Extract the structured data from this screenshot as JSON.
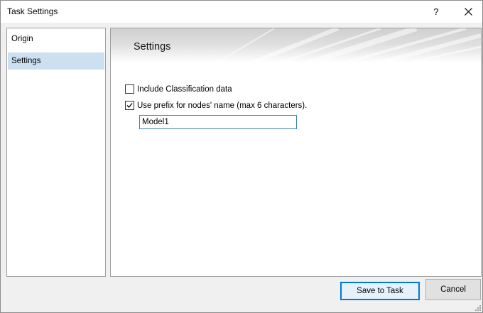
{
  "window": {
    "title": "Task Settings",
    "help_label": "?",
    "close_icon": "close-icon"
  },
  "sidebar": {
    "items": [
      {
        "label": "Origin",
        "selected": false
      },
      {
        "label": "Settings",
        "selected": true
      }
    ],
    "selected_color": "#cce0f2"
  },
  "panel": {
    "title": "Settings",
    "options": [
      {
        "label": "Include Classification data",
        "checked": false
      },
      {
        "label": "Use prefix for nodes' name (max 6 characters).",
        "checked": true
      }
    ],
    "prefix_value": "Model1"
  },
  "footer": {
    "save_label": "Save to Task",
    "cancel_label": "Cancel"
  },
  "colors": {
    "accent": "#0078d7",
    "input_border": "#3c7fb1"
  }
}
